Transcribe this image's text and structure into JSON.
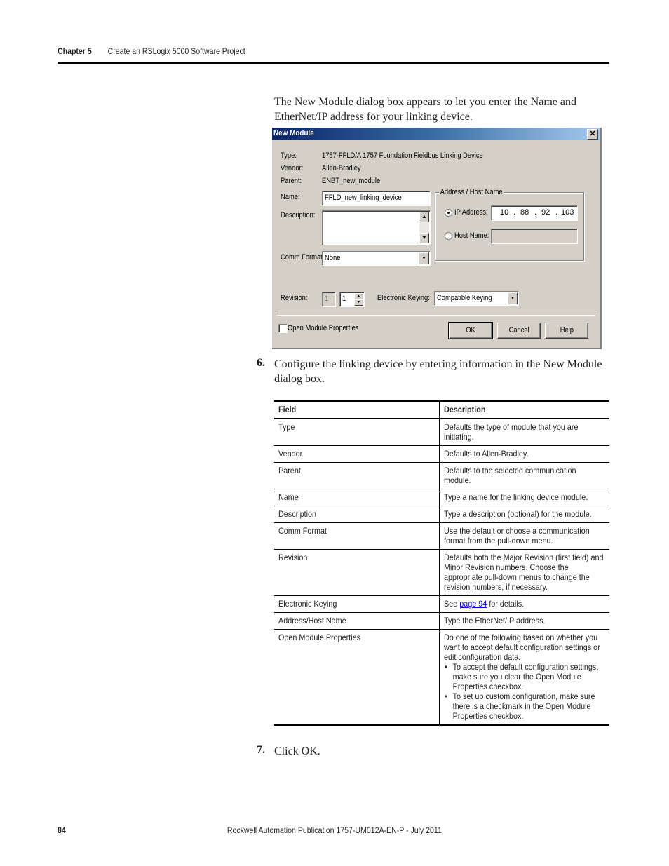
{
  "header": {
    "chapter": "Chapter 5",
    "title": "Create an RSLogix 5000 Software Project"
  },
  "intro_text": "The New Module dialog box appears to let you enter the Name and EtherNet/IP address for your linking device.",
  "dialog": {
    "title": "New Module",
    "close_icon": "close-x-icon",
    "type_label": "Type:",
    "type_value": "1757-FFLD/A 1757 Foundation Fieldbus Linking Device",
    "vendor_label": "Vendor:",
    "vendor_value": "Allen-Bradley",
    "parent_label": "Parent:",
    "parent_value": "ENBT_new_module",
    "name_label": "Name:",
    "name_value": "FFLD_new_linking_device",
    "description_label": "Description:",
    "description_value": "",
    "comm_format_label": "Comm Format:",
    "comm_format_value": "None",
    "address_group_label": "Address / Host Name",
    "ip_address_label": "IP Address:",
    "ip_address_selected": true,
    "ip_octets": [
      "10",
      "88",
      "92",
      "103"
    ],
    "host_name_label": "Host Name:",
    "host_name_value": "",
    "revision_label": "Revision:",
    "revision_major": "1",
    "revision_minor": "1",
    "electronic_keying_label": "Electronic Keying:",
    "electronic_keying_value": "Compatible Keying",
    "open_module_properties_label": "Open Module Properties",
    "open_module_properties_checked": false,
    "ok_label": "OK",
    "cancel_label": "Cancel",
    "help_label": "Help"
  },
  "step6": {
    "number": "6.",
    "text": "Configure the linking device by entering information in the New Module dialog box."
  },
  "table": {
    "headers": [
      "Field",
      "Description"
    ],
    "rows": [
      {
        "field": "Type",
        "description": "Defaults the type of module that you are initiating."
      },
      {
        "field": "Vendor",
        "description": "Defaults to Allen-Bradley."
      },
      {
        "field": "Parent",
        "description": "Defaults to the selected communication module."
      },
      {
        "field": "Name",
        "description": "Type a name for the linking device module."
      },
      {
        "field": "Description",
        "description": "Type a description (optional) for the module."
      },
      {
        "field": "Comm Format",
        "description": "Use the default or choose a communication format from the pull-down menu."
      },
      {
        "field": "Revision",
        "description": "Defaults both the Major Revision (first field) and Minor Revision numbers. Choose the appropriate pull-down menus to change the revision numbers, if necessary."
      },
      {
        "field": "Electronic Keying",
        "description_pre": "See ",
        "link": "page 94",
        "description_post": " for details."
      },
      {
        "field": "Address/Host Name",
        "description": "Type the EtherNet/IP address."
      },
      {
        "field": "Open Module Properties",
        "description": "Do one of the following based on whether you want to accept default configuration settings or edit configuration data.",
        "bullets": [
          "To accept the default configuration settings, make sure you clear the Open Module Properties checkbox.",
          "To set up custom configuration, make sure there is a checkmark in the Open Module Properties checkbox."
        ]
      }
    ]
  },
  "step7": {
    "number": "7.",
    "text": "Click OK."
  },
  "footer": {
    "page_number": "84",
    "publication": "Rockwell Automation Publication 1757-UM012A-EN-P - July 2011"
  },
  "colors": {
    "link": "#0000ee",
    "dialog_face": "#d4d0c8",
    "titlebar_start": "#0a246a",
    "titlebar_end": "#a6caf0"
  }
}
